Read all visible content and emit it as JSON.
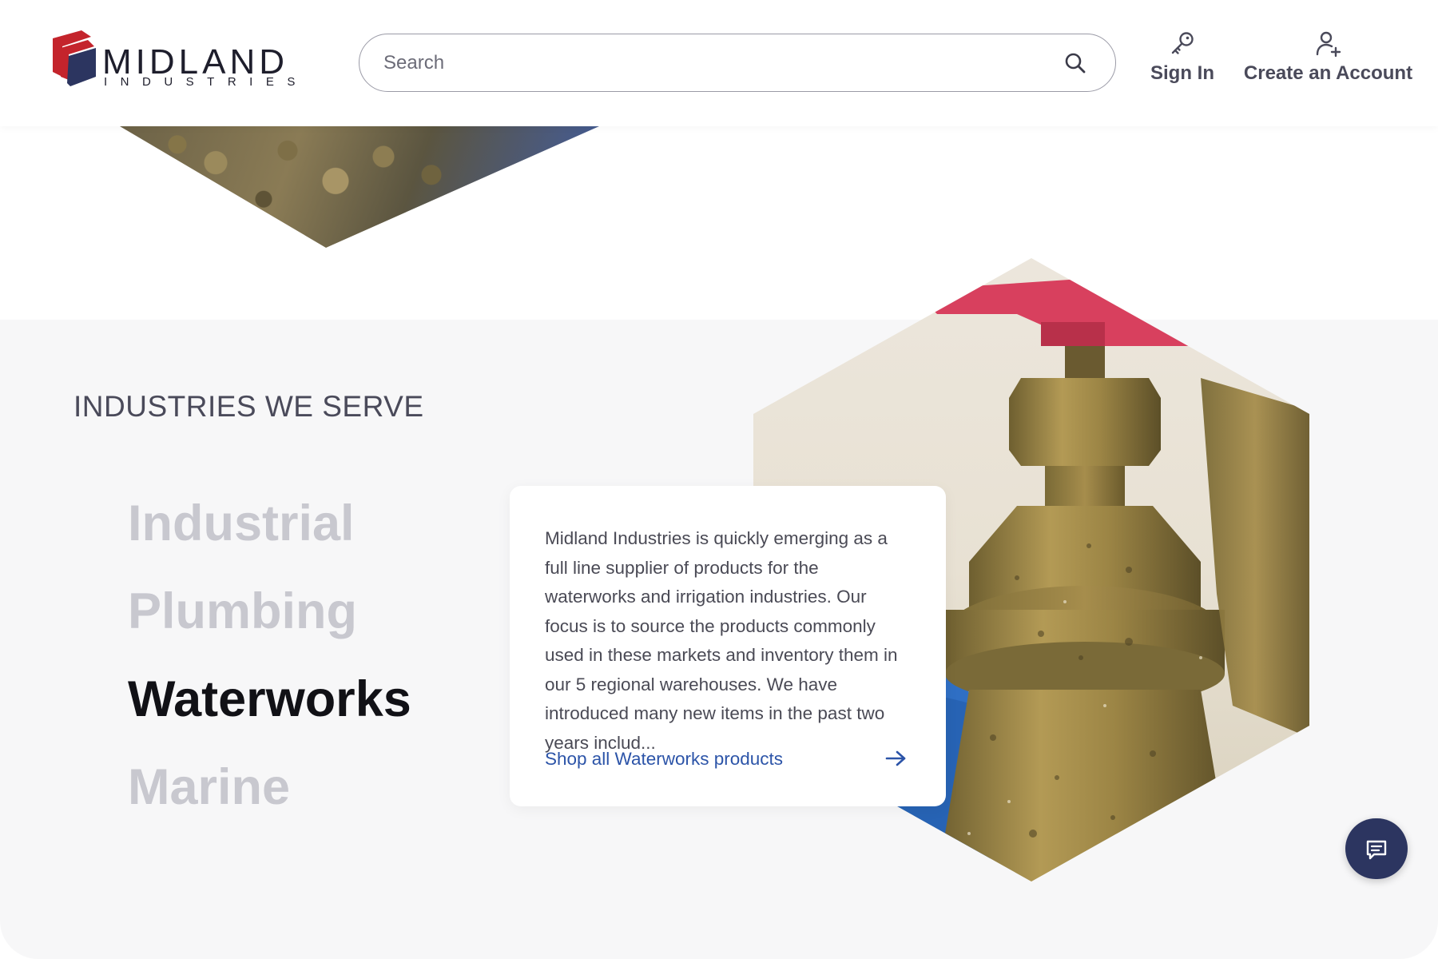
{
  "brand": {
    "name": "MIDLAND",
    "sub": "INDUSTRIES",
    "colors": {
      "red": "#c4242c",
      "navy": "#2c3560"
    }
  },
  "search": {
    "placeholder": "Search",
    "value": ""
  },
  "account": {
    "sign_in": "Sign In",
    "create_account": "Create an Account"
  },
  "industries": {
    "heading": "INDUSTRIES WE SERVE",
    "items": [
      {
        "label": "Industrial",
        "active": false
      },
      {
        "label": "Plumbing",
        "active": false
      },
      {
        "label": "Waterworks",
        "active": true
      },
      {
        "label": "Marine",
        "active": false
      }
    ],
    "card": {
      "description": "Midland Industries is quickly emerging as a full line supplier of products for the waterworks and irrigation industries. Our focus is to source the products commonly used in these markets and inventory them in our 5 regional warehouses. We have introduced many new items in the past two years includ...",
      "link_label": "Shop all Waterworks products"
    }
  },
  "icons": {
    "search": "search-icon",
    "sign_in": "key-icon",
    "create_account": "user-plus-icon",
    "shop_link": "arrow-right-icon",
    "chat": "chat-icon"
  },
  "colors": {
    "link": "#2c54a8",
    "inactive_industry": "#c8c8cf",
    "active_industry": "#111116",
    "section_bg": "#f7f7f8",
    "chat_button": "#2c3560"
  }
}
